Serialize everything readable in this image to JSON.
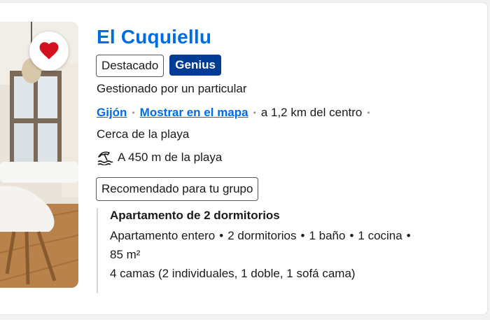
{
  "listing": {
    "title": "El Cuquiellu",
    "badges": {
      "featured": "Destacado",
      "genius": "Genius"
    },
    "managed_by": "Gestionado por un particular",
    "location": {
      "city": "Gijón",
      "map_link": "Mostrar en el mapa",
      "distance": "a 1,2 km del centro"
    },
    "near": "Cerca de la playa",
    "beach_distance": "A 450 m de la playa",
    "recommended": "Recomendado para tu grupo",
    "unit": {
      "name": "Apartamento de 2 dormitorios",
      "features": [
        "Apartamento entero",
        "2 dormitorios",
        "1 baño",
        "1 cocina"
      ],
      "area": "85 m²",
      "beds": "4 camas (2 individuales, 1 doble, 1 sofá cama)"
    }
  },
  "colors": {
    "link_blue": "#006ce4",
    "genius_blue": "#003b95",
    "heart_red": "#d4111e"
  },
  "icons": {
    "favorite": "heart-icon",
    "beach": "beach-umbrella-icon"
  }
}
